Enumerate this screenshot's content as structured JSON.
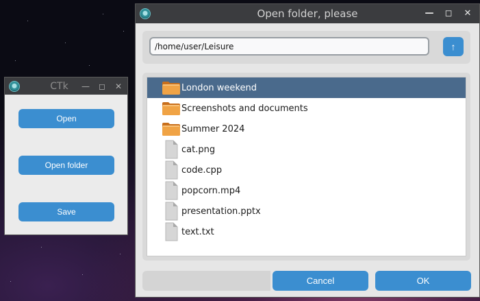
{
  "main_window": {
    "title": "CTk",
    "buttons": {
      "open": "Open",
      "open_folder": "Open folder",
      "save": "Save"
    }
  },
  "dialog": {
    "title": "Open folder, please",
    "path": "/home/user/Leisure",
    "up_label": "↑",
    "items": [
      {
        "label": "London weekend",
        "icon": "folder-icon",
        "selected": true
      },
      {
        "label": "Screenshots and documents",
        "icon": "folder-icon",
        "selected": false
      },
      {
        "label": "Summer 2024",
        "icon": "folder-icon",
        "selected": false
      },
      {
        "label": "cat.png",
        "icon": "file-icon",
        "selected": false
      },
      {
        "label": "code.cpp",
        "icon": "file-icon",
        "selected": false
      },
      {
        "label": "popcorn.mp4",
        "icon": "file-icon",
        "selected": false
      },
      {
        "label": "presentation.pptx",
        "icon": "file-icon",
        "selected": false
      },
      {
        "label": "text.txt",
        "icon": "file-icon",
        "selected": false
      }
    ],
    "cancel_label": "Cancel",
    "ok_label": "OK"
  },
  "colors": {
    "accent": "#3b8ed0",
    "selection": "#4a6a8c",
    "titlebar": "#3b3c3f",
    "folder": "#e8922e"
  }
}
